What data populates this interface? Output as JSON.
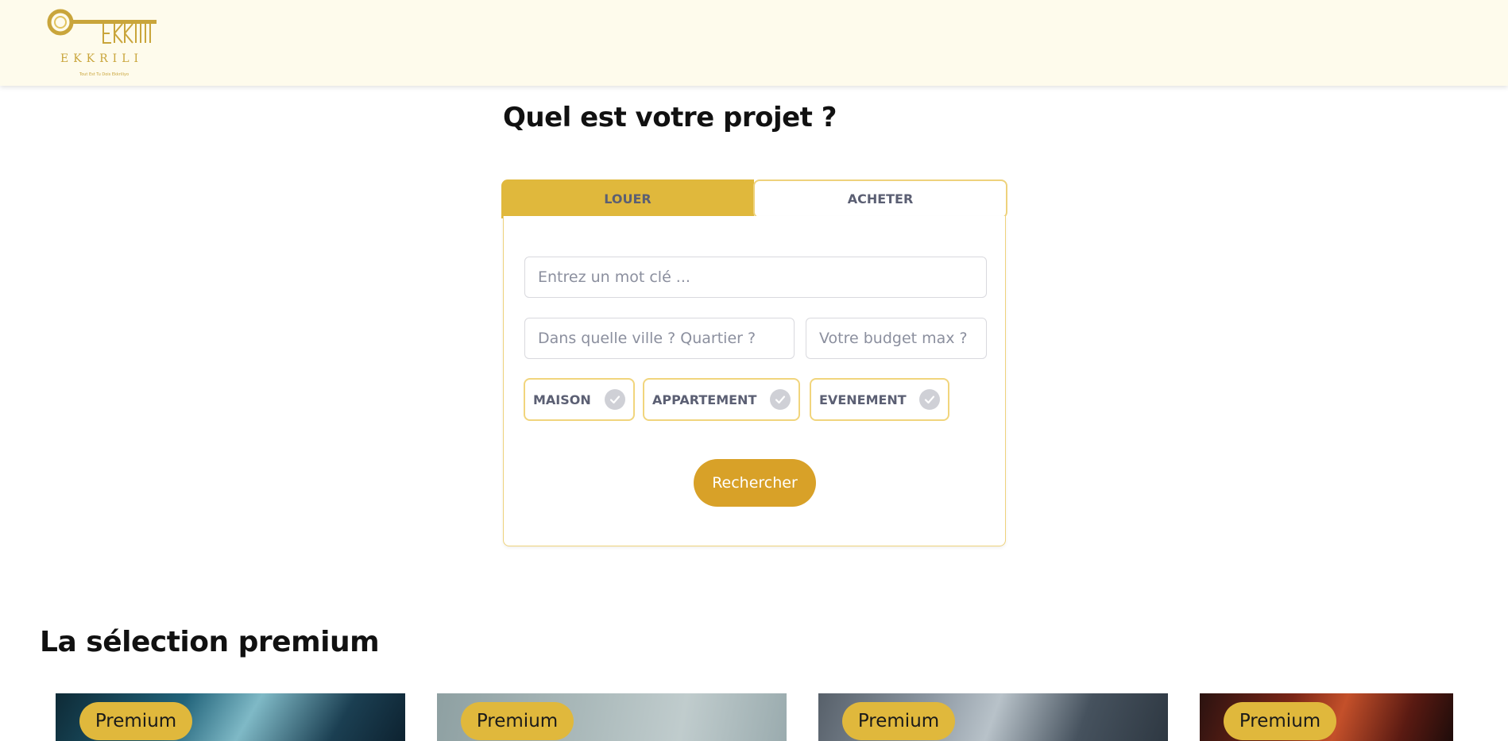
{
  "header": {
    "logo_text": "EKKRILI",
    "logo_tagline": "Tout Est Tu Dois Ekkriliyo"
  },
  "project": {
    "title": "Quel est votre projet ?",
    "tabs": [
      {
        "label": "LOUER",
        "active": true
      },
      {
        "label": "ACHETER",
        "active": false
      }
    ],
    "keyword_placeholder": "Entrez un mot clé ...",
    "city_placeholder": "Dans quelle ville ? Quartier ?",
    "budget_placeholder": "Votre budget max ?",
    "property_types": [
      {
        "label": "MAISON",
        "icon": "check-circle-icon"
      },
      {
        "label": "APPARTEMENT",
        "icon": "check-circle-icon"
      },
      {
        "label": "EVENEMENT",
        "icon": "check-circle-icon"
      }
    ],
    "search_button": "Rechercher"
  },
  "premium": {
    "title": "La sélection premium",
    "cards": [
      {
        "badge": "Premium"
      },
      {
        "badge": "Premium"
      },
      {
        "badge": "Premium"
      },
      {
        "badge": "Premium"
      }
    ]
  },
  "colors": {
    "header_bg": "#fefbec",
    "accent_gold": "#e0b83c",
    "button_gold": "#d8a128",
    "border_gold": "#eed27c"
  }
}
